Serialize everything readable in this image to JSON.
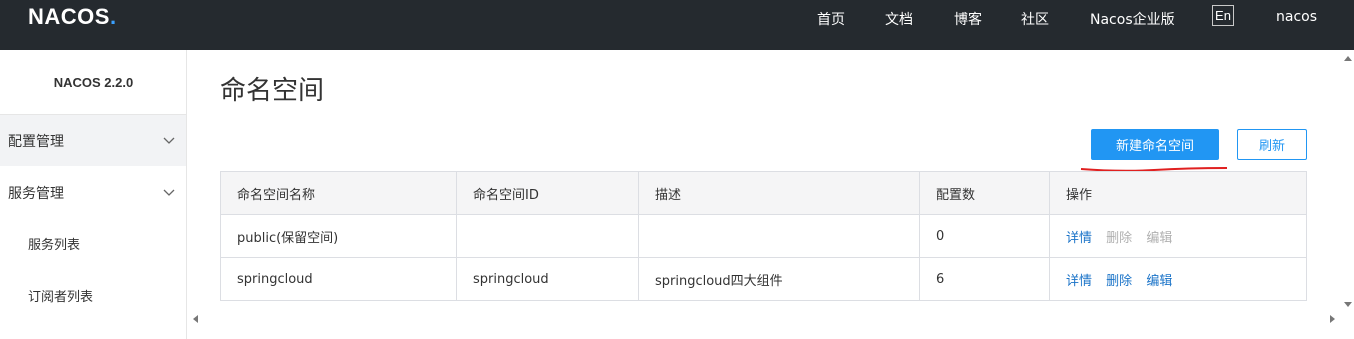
{
  "header": {
    "logo_text": "NACOS",
    "logo_dot": ".",
    "nav": [
      "首页",
      "文档",
      "博客",
      "社区",
      "Nacos企业版"
    ],
    "lang": "En",
    "user": "nacos"
  },
  "sidebar": {
    "version": "NACOS 2.2.0",
    "groups": [
      {
        "label": "配置管理"
      },
      {
        "label": "服务管理"
      }
    ],
    "subitems": [
      {
        "label": "服务列表"
      },
      {
        "label": "订阅者列表"
      }
    ]
  },
  "main": {
    "title": "命名空间",
    "create_button": "新建命名空间",
    "refresh_button": "刷新",
    "annotation_color": "#e02020",
    "accent_color": "#2196f3",
    "table": {
      "headers": [
        "命名空间名称",
        "命名空间ID",
        "描述",
        "配置数",
        "操作"
      ],
      "rows": [
        {
          "name": "public(保留空间)",
          "id": "",
          "desc": "",
          "count": "0",
          "ops": [
            {
              "label": "详情",
              "enabled": true
            },
            {
              "label": "删除",
              "enabled": false
            },
            {
              "label": "编辑",
              "enabled": false
            }
          ]
        },
        {
          "name": "springcloud",
          "id": "springcloud",
          "desc": "springcloud四大组件",
          "count": "6",
          "ops": [
            {
              "label": "详情",
              "enabled": true
            },
            {
              "label": "删除",
              "enabled": true
            },
            {
              "label": "编辑",
              "enabled": true
            }
          ]
        }
      ]
    }
  }
}
